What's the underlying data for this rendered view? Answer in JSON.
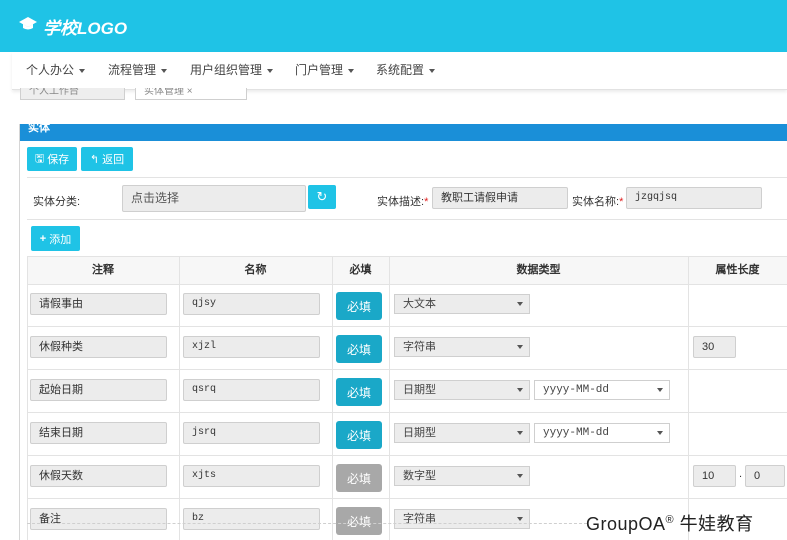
{
  "header": {
    "logo_text": "学校LOGO",
    "logo_icon": "graduation-cap-icon",
    "bg_color": "#1fc3e6"
  },
  "nav": {
    "items": [
      "个人办公",
      "流程管理",
      "用户组织管理",
      "门户管理",
      "系统配置"
    ]
  },
  "tabs": {
    "items": [
      "个人工作台",
      "实体管理"
    ]
  },
  "panel": {
    "title": "实体"
  },
  "toolbar": {
    "save_label": "保存",
    "back_label": "返回",
    "add_label": "添加"
  },
  "form": {
    "category_label": "实体分类:",
    "category_placeholder": "点击选择",
    "desc_label": "实体描述:",
    "desc_value": "教职工请假申请",
    "name_label": "实体名称:",
    "name_value": "jzgqjsq"
  },
  "table": {
    "headers": [
      "注释",
      "名称",
      "必填",
      "数据类型",
      "属性长度"
    ],
    "rows": [
      {
        "comment": "请假事由",
        "name": "qjsy",
        "required": "必填",
        "required_on": true,
        "type": "大文本",
        "format": "",
        "length": "",
        "decimal": ""
      },
      {
        "comment": "休假种类",
        "name": "xjzl",
        "required": "必填",
        "required_on": true,
        "type": "字符串",
        "format": "",
        "length": "30",
        "decimal": ""
      },
      {
        "comment": "起始日期",
        "name": "qsrq",
        "required": "必填",
        "required_on": true,
        "type": "日期型",
        "format": "yyyy-MM-dd",
        "length": "",
        "decimal": ""
      },
      {
        "comment": "结束日期",
        "name": "jsrq",
        "required": "必填",
        "required_on": true,
        "type": "日期型",
        "format": "yyyy-MM-dd",
        "length": "",
        "decimal": ""
      },
      {
        "comment": "休假天数",
        "name": "xjts",
        "required": "必填",
        "required_on": false,
        "type": "数字型",
        "format": "",
        "length": "10",
        "decimal": "0"
      },
      {
        "comment": "备注",
        "name": "bz",
        "required": "必填",
        "required_on": false,
        "type": "字符串",
        "format": "",
        "length": "",
        "decimal": ""
      }
    ]
  },
  "watermark": {
    "text": "GroupOA",
    "mark": "®",
    "suffix": " 牛娃教育"
  }
}
